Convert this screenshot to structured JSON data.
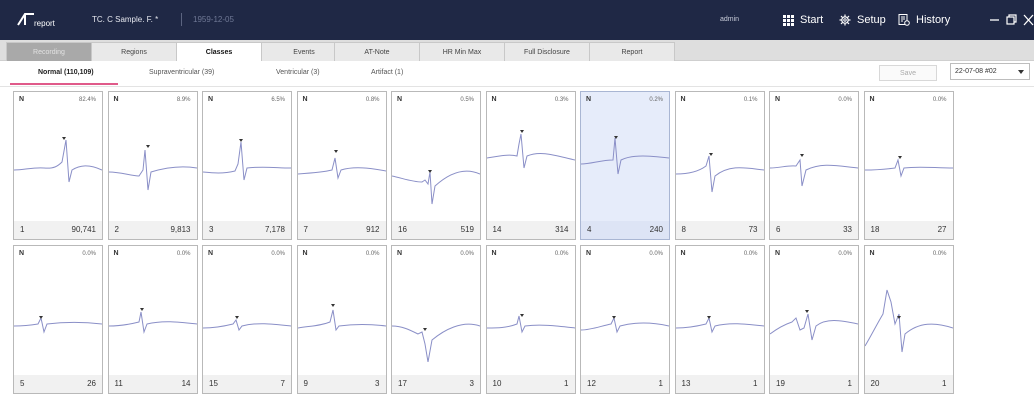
{
  "header": {
    "logo_text": "report",
    "patient": "TC. C Sample. F. *",
    "dob": "1959-12-05",
    "user": "admin",
    "nav": [
      {
        "label": "Start",
        "icon": "grid-icon"
      },
      {
        "label": "Setup",
        "icon": "gear-icon"
      },
      {
        "label": "History",
        "icon": "history-icon"
      }
    ]
  },
  "tabs": [
    "Recording",
    "Regions",
    "Classes",
    "Events",
    "AT-Note",
    "HR Min Max",
    "Full Disclosure",
    "Report"
  ],
  "active_tab": "Classes",
  "subtabs": [
    "Normal (110,109)",
    "Supraventricular (39)",
    "Ventricular (3)",
    "Artifact (1)"
  ],
  "save_label": "Save",
  "date_select": "22-07-08 #02",
  "classes": [
    {
      "label": "N",
      "pct": "82.4%",
      "id": "1",
      "count": "90,741"
    },
    {
      "label": "N",
      "pct": "8.9%",
      "id": "2",
      "count": "9,813"
    },
    {
      "label": "N",
      "pct": "6.5%",
      "id": "3",
      "count": "7,178"
    },
    {
      "label": "N",
      "pct": "0.8%",
      "id": "7",
      "count": "912"
    },
    {
      "label": "N",
      "pct": "0.5%",
      "id": "16",
      "count": "519"
    },
    {
      "label": "N",
      "pct": "0.3%",
      "id": "14",
      "count": "314"
    },
    {
      "label": "N",
      "pct": "0.2%",
      "id": "4",
      "count": "240",
      "selected": true
    },
    {
      "label": "N",
      "pct": "0.1%",
      "id": "8",
      "count": "73"
    },
    {
      "label": "N",
      "pct": "0.0%",
      "id": "6",
      "count": "33"
    },
    {
      "label": "N",
      "pct": "0.0%",
      "id": "18",
      "count": "27"
    },
    {
      "label": "N",
      "pct": "0.0%",
      "id": "5",
      "count": "26"
    },
    {
      "label": "N",
      "pct": "0.0%",
      "id": "11",
      "count": "14"
    },
    {
      "label": "N",
      "pct": "0.0%",
      "id": "15",
      "count": "7"
    },
    {
      "label": "N",
      "pct": "0.0%",
      "id": "9",
      "count": "3"
    },
    {
      "label": "N",
      "pct": "0.0%",
      "id": "17",
      "count": "3"
    },
    {
      "label": "N",
      "pct": "0.0%",
      "id": "10",
      "count": "1"
    },
    {
      "label": "N",
      "pct": "0.0%",
      "id": "12",
      "count": "1"
    },
    {
      "label": "N",
      "pct": "0.0%",
      "id": "13",
      "count": "1"
    },
    {
      "label": "N",
      "pct": "0.0%",
      "id": "19",
      "count": "1"
    },
    {
      "label": "N",
      "pct": "0.0%",
      "id": "20",
      "count": "1"
    }
  ],
  "colors": {
    "header_bg": "#1f2845",
    "waveform": "#8a8fc7",
    "active_underline": "#e05a8a",
    "selected_card": "#e6ecfa"
  }
}
